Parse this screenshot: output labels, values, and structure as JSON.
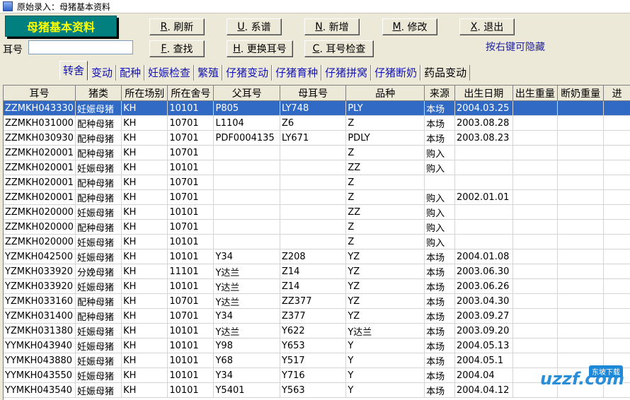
{
  "window": {
    "title": "原始录入：母猪基本资料"
  },
  "banner": "母猪基本资料",
  "toolbar": {
    "refresh": {
      "key": "R",
      "label": ". 刷新"
    },
    "pedigree": {
      "key": "U",
      "label": ". 系谱"
    },
    "add": {
      "key": "N",
      "label": ". 新增"
    },
    "modify": {
      "key": "M",
      "label": ". 修改"
    },
    "exit": {
      "key": "X",
      "label": ". 退出"
    },
    "find": {
      "key": "F",
      "label": ". 查找"
    },
    "change_ear": {
      "key": "H",
      "label": ". 更换耳号"
    },
    "ear_check": {
      "key": "C",
      "label": ". 耳号检查"
    }
  },
  "ear_label": "耳号",
  "ear_value": "",
  "hint": "按右键可隐藏",
  "tabs": [
    "转舍",
    "变动",
    "配种",
    "妊娠检查",
    "繁殖",
    "仔猪变动",
    "仔猪育种",
    "仔猪拼窝",
    "仔猪断奶",
    "药品变动"
  ],
  "grid": {
    "columns": [
      "耳号",
      "猪类",
      "所在场别",
      "所在舍号",
      "父耳号",
      "母耳号",
      "品种",
      "来源",
      "出生日期",
      "出生重量",
      "断奶重量",
      "进"
    ],
    "rows": [
      [
        "ZZMKH043330",
        "妊娠母猪",
        "KH",
        "10101",
        "P805",
        "LY748",
        "PLY",
        "本场",
        "2004.03.25",
        "",
        "",
        ""
      ],
      [
        "ZZMKH031000",
        "配种母猪",
        "KH",
        "10701",
        "L1104",
        "Z6",
        "Z",
        "本场",
        "2003.08.28",
        "",
        "",
        ""
      ],
      [
        "ZZMKH030930",
        "配种母猪",
        "KH",
        "10701",
        "PDF0004135",
        "LY671",
        "PDLY",
        "本场",
        "2003.08.23",
        "",
        "",
        ""
      ],
      [
        "ZZMKH020001",
        "配种母猪",
        "KH",
        "10701",
        "",
        "",
        "Z",
        "购入",
        "",
        "",
        "",
        ""
      ],
      [
        "ZZMKH020001",
        "妊娠母猪",
        "KH",
        "10101",
        "",
        "",
        "ZZ",
        "购入",
        "",
        "",
        "",
        ""
      ],
      [
        "ZZMKH020001",
        "配种母猪",
        "KH",
        "10701",
        "",
        "",
        "Z",
        "",
        "",
        "",
        "",
        ""
      ],
      [
        "ZZMKH020001",
        "配种母猪",
        "KH",
        "10701",
        "",
        "",
        "Z",
        "购入",
        "2002.01.01",
        "",
        "",
        ""
      ],
      [
        "ZZMKH020000",
        "妊娠母猪",
        "KH",
        "10101",
        "",
        "",
        "ZZ",
        "购入",
        "",
        "",
        "",
        ""
      ],
      [
        "ZZMKH020000",
        "配种母猪",
        "KH",
        "10701",
        "",
        "",
        "Z",
        "购入",
        "",
        "",
        "",
        ""
      ],
      [
        "ZZMKH020000",
        "妊娠母猪",
        "KH",
        "10101",
        "",
        "",
        "Z",
        "购入",
        "",
        "",
        "",
        ""
      ],
      [
        "YZMKH042500",
        "妊娠母猪",
        "KH",
        "10101",
        "Y34",
        "Z208",
        "YZ",
        "本场",
        "2004.01.08",
        "",
        "",
        ""
      ],
      [
        "YZMKH033920",
        "分娩母猪",
        "KH",
        "11101",
        "Y达兰",
        "Z14",
        "YZ",
        "本场",
        "2003.06.30",
        "",
        "",
        ""
      ],
      [
        "YZMKH033920",
        "妊娠母猪",
        "KH",
        "10101",
        "Y达兰",
        "Z14",
        "YZ",
        "本场",
        "2003.06.26",
        "",
        "",
        ""
      ],
      [
        "YZMKH033160",
        "配种母猪",
        "KH",
        "10701",
        "Y达兰",
        "ZZ377",
        "YZ",
        "本场",
        "2003.04.30",
        "",
        "",
        ""
      ],
      [
        "YZMKH031400",
        "配种母猪",
        "KH",
        "10701",
        "Y34",
        "Z377",
        "YZ",
        "本场",
        "2003.09.27",
        "",
        "",
        ""
      ],
      [
        "YZMKH031380",
        "妊娠母猪",
        "KH",
        "10101",
        "Y达兰",
        "Y622",
        "Y达兰",
        "本场",
        "2003.09.20",
        "",
        "",
        ""
      ],
      [
        "YYMKH043940",
        "妊娠母猪",
        "KH",
        "10101",
        "Y98",
        "Y653",
        "Y",
        "本场",
        "2004.05.13",
        "",
        "",
        ""
      ],
      [
        "YYMKH043880",
        "妊娠母猪",
        "KH",
        "10101",
        "Y68",
        "Y517",
        "Y",
        "本场",
        "2004.05.1",
        "",
        "",
        ""
      ],
      [
        "YYMKH043550",
        "妊娠母猪",
        "KH",
        "10101",
        "Y34",
        "Y716",
        "Y",
        "本场",
        "2004.04",
        "",
        "",
        ""
      ],
      [
        "YYMKH043540",
        "妊娠母猪",
        "KH",
        "10101",
        "Y5401",
        "Y563",
        "Y",
        "本场",
        "2004.04.12",
        "",
        "",
        ""
      ]
    ]
  },
  "watermark": {
    "badge": "东坡下载",
    "text": "uzzf.com"
  }
}
